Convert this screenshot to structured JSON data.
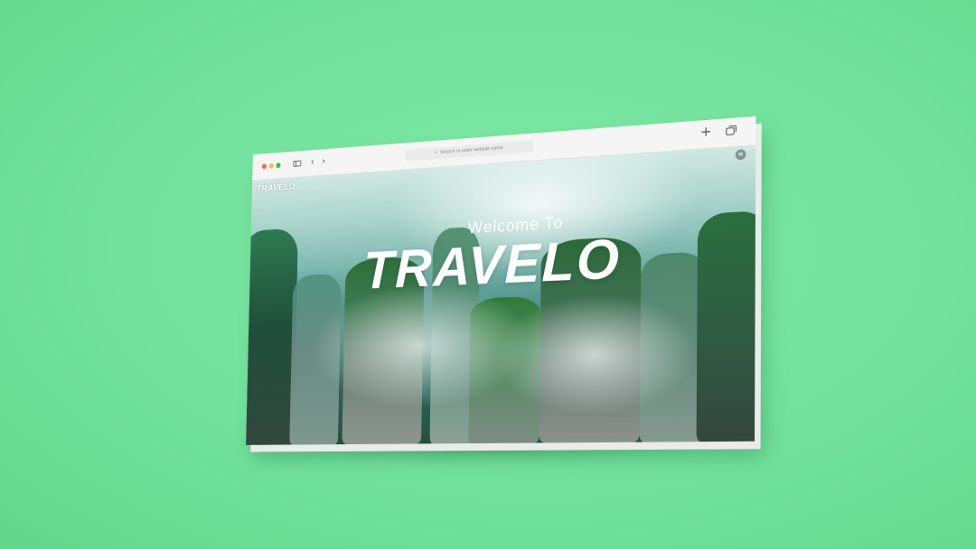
{
  "browser": {
    "address_placeholder": "Search or enter website name",
    "icons": [
      "sidebar-icon",
      "chevron-left-icon",
      "chevron-right-icon",
      "search-icon",
      "plus-icon",
      "tabs-icon"
    ],
    "traffic_lights": [
      "#ff5f57",
      "#febc2e",
      "#28c840"
    ]
  },
  "site": {
    "logo": "TRAVELO",
    "welcome": "Welcome To",
    "title": "TRAVELO",
    "menu_icon": "menu-icon"
  },
  "colors": {
    "background": "#72e29c",
    "accent_white": "#ffffff"
  }
}
